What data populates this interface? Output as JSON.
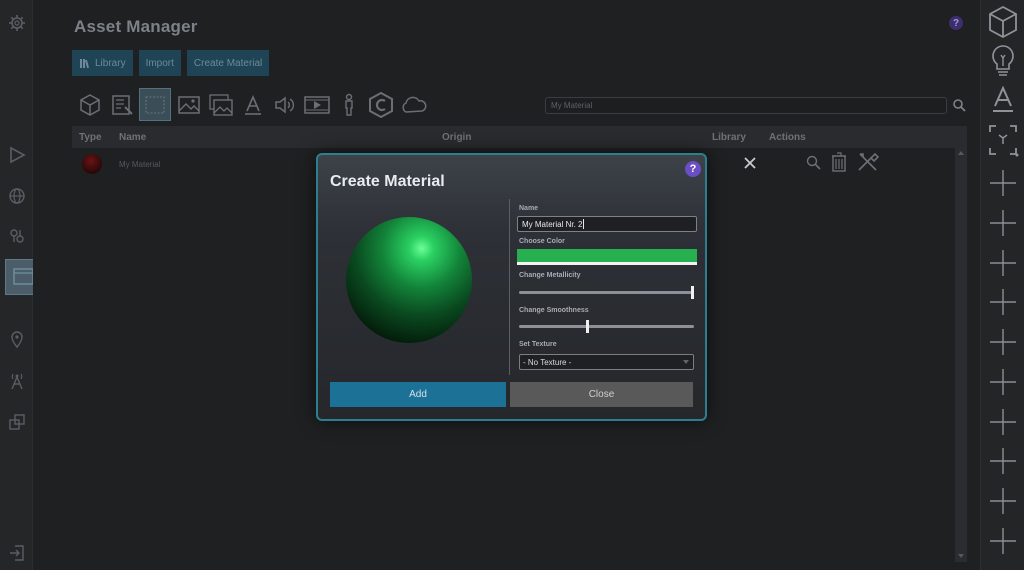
{
  "app": {
    "title": "Asset Manager",
    "help": "?"
  },
  "nav": {
    "library_label": "Library",
    "import_label": "Import",
    "create_material_label": "Create Material"
  },
  "asset_types": [
    "cube-icon",
    "model-text-icon",
    "material-icon",
    "image-icon",
    "images-icon",
    "font-icon",
    "audio-icon",
    "video-icon",
    "person-icon",
    "script-icon",
    "cloud-icon"
  ],
  "search": {
    "value": "My Material"
  },
  "table": {
    "headers": {
      "type": "Type",
      "name": "Name",
      "origin": "Origin",
      "library": "Library",
      "actions": "Actions"
    },
    "rows": [
      {
        "name": "My Material",
        "color": "#6a1414"
      }
    ]
  },
  "modal": {
    "title": "Create Material",
    "help": "?",
    "name_label": "Name",
    "name_value": "My Material Nr. 2",
    "color_label": "Choose Color",
    "color_value": "#28b050",
    "metallicity_label": "Change Metallicity",
    "metallicity_value": 1.0,
    "smoothness_label": "Change Smoothness",
    "smoothness_value": 0.38,
    "texture_label": "Set Texture",
    "texture_value": "- No Texture -",
    "add_label": "Add",
    "close_label": "Close"
  },
  "colors": {
    "accent": "#1b7196",
    "border": "#2d7f8f",
    "help": "#6a4fc4",
    "sphere": "#2ad062"
  }
}
